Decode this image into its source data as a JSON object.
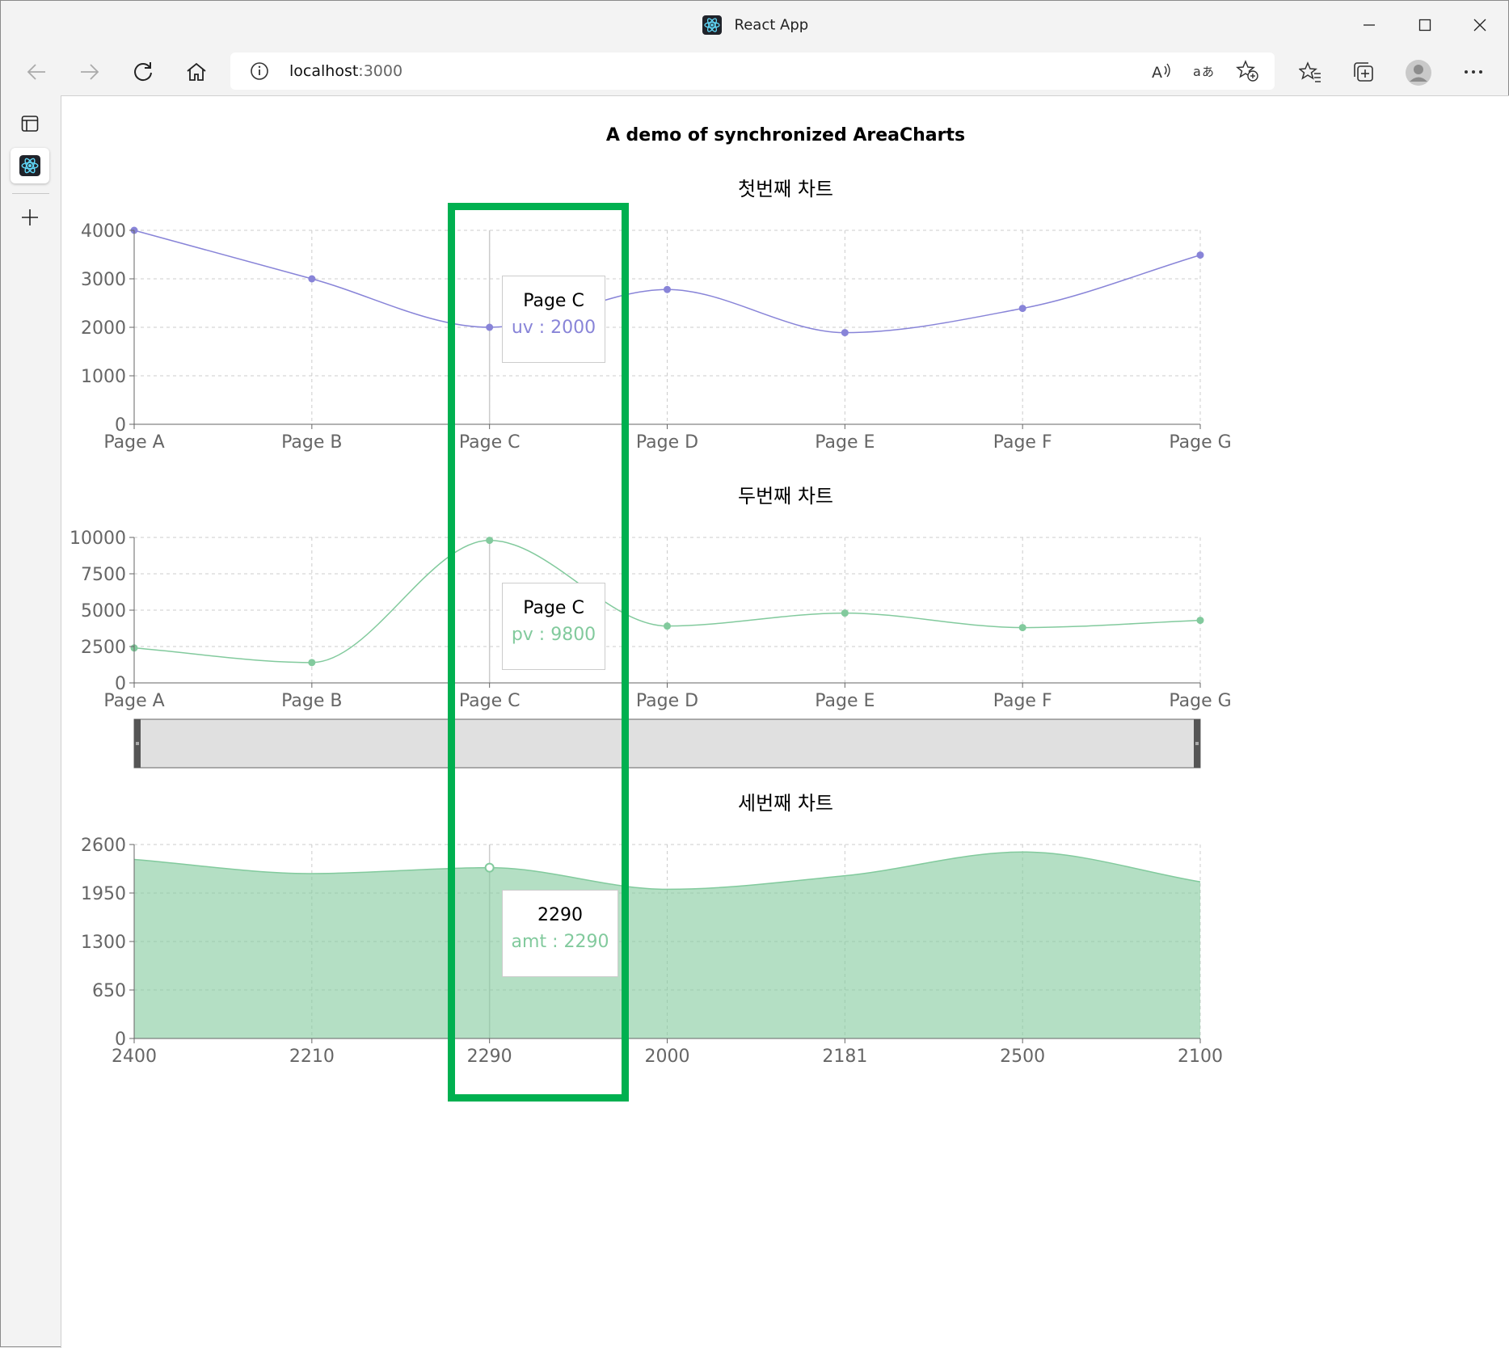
{
  "browser": {
    "tab_title": "React App",
    "url_host": "localhost",
    "url_port": ":3000"
  },
  "page": {
    "title": "A demo of synchronized AreaCharts"
  },
  "colors": {
    "uv": "#8884d8",
    "pv": "#82ca9d",
    "highlight": "#00b050",
    "brush_fill": "#e0e0e0"
  },
  "chart_data": [
    {
      "type": "line",
      "title": "첫번째 차트",
      "categories": [
        "Page A",
        "Page B",
        "Page C",
        "Page D",
        "Page E",
        "Page F",
        "Page G"
      ],
      "series": [
        {
          "name": "uv",
          "values": [
            4000,
            3000,
            2000,
            2780,
            1890,
            2390,
            3490
          ]
        }
      ],
      "yticks": [
        0,
        1000,
        2000,
        3000,
        4000
      ],
      "ylim": [
        0,
        4000
      ],
      "grid": true,
      "tooltip": {
        "label": "Page C",
        "text": "uv : 2000"
      }
    },
    {
      "type": "line",
      "title": "두번째 차트",
      "categories": [
        "Page A",
        "Page B",
        "Page C",
        "Page D",
        "Page E",
        "Page F",
        "Page G"
      ],
      "series": [
        {
          "name": "pv",
          "values": [
            2400,
            1398,
            9800,
            3908,
            4800,
            3800,
            4300
          ]
        }
      ],
      "yticks": [
        0,
        2500,
        5000,
        7500,
        10000
      ],
      "ylim": [
        0,
        10000
      ],
      "grid": true,
      "brush": true,
      "tooltip": {
        "label": "Page C",
        "text": "pv : 9800"
      }
    },
    {
      "type": "area",
      "title": "세번째 차트",
      "categories": [
        "2400",
        "2210",
        "2290",
        "2000",
        "2181",
        "2500",
        "2100"
      ],
      "series": [
        {
          "name": "amt",
          "values": [
            2400,
            2210,
            2290,
            2000,
            2181,
            2500,
            2100
          ]
        }
      ],
      "yticks": [
        0,
        650,
        1300,
        1950,
        2600
      ],
      "ylim": [
        0,
        2600
      ],
      "grid": true,
      "tooltip": {
        "label": "2290",
        "text": "amt : 2290"
      }
    }
  ]
}
